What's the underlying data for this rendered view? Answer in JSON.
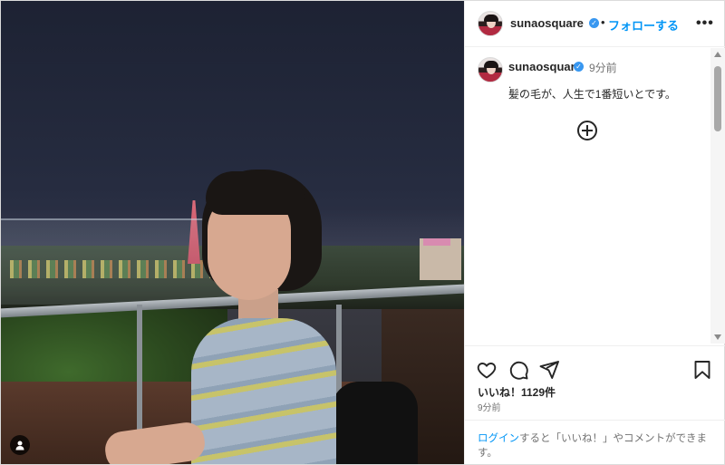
{
  "post": {
    "username": "sunaosquare",
    "verified_mark": "✓",
    "separator": "•",
    "follow_label": "フォローする",
    "more_label": "•••"
  },
  "comment": {
    "username": "sunaosquare",
    "time": "9分前",
    "line1": ".",
    "line2": "髪の毛が、人生で1番短いとです。"
  },
  "actions": {
    "likes": "いいね！1129件",
    "time": "9分前"
  },
  "footer": {
    "login_link": "ログイン",
    "login_rest": "すると「いいね！」やコメントができます。"
  },
  "icons": [
    "heart-icon",
    "comment-icon",
    "share-icon",
    "bookmark-icon",
    "add-comment-icon",
    "user-tag-icon",
    "more-icon"
  ],
  "colors": {
    "accent": "#0095f6",
    "verified": "#3897f0",
    "text": "#262626",
    "muted": "#737373"
  }
}
